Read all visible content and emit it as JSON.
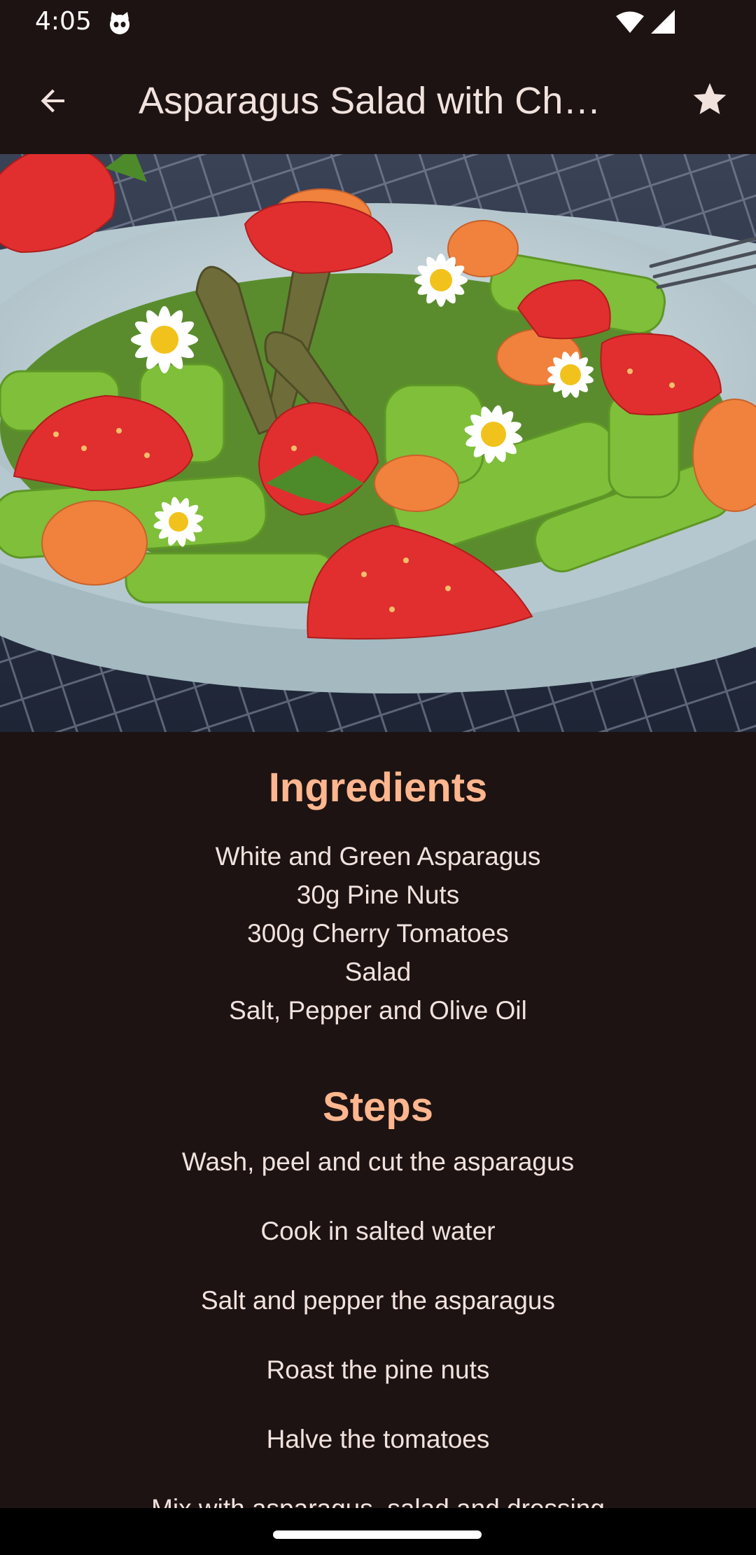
{
  "status_bar": {
    "time": "4:05",
    "icons": [
      "cat-icon",
      "wifi-icon",
      "signal-icon"
    ]
  },
  "app_bar": {
    "title": "Asparagus Salad with Ch…",
    "back_icon": "arrow-back-icon",
    "favorite_icon": "star-icon"
  },
  "hero_image": {
    "alt": "Asparagus salad with strawberries and daisies in a bowl"
  },
  "ingredients": {
    "title": "Ingredients",
    "items": [
      "White and Green Asparagus",
      "30g Pine Nuts",
      "300g Cherry Tomatoes",
      "Salad",
      "Salt, Pepper and Olive Oil"
    ]
  },
  "steps": {
    "title": "Steps",
    "items": [
      "Wash, peel and cut the asparagus",
      "Cook in salted water",
      "Salt and pepper the asparagus",
      "Roast the pine nuts",
      "Halve the tomatoes",
      "Mix with asparagus, salad and dressing"
    ]
  },
  "colors": {
    "background": "#1d1312",
    "accent": "#ffb68e",
    "text": "#f1e2dd"
  }
}
